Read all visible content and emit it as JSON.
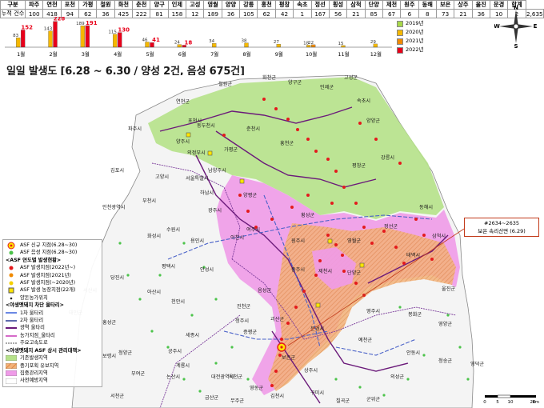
{
  "table": {
    "headers": [
      "구분",
      "파주",
      "연천",
      "포천",
      "가평",
      "철원",
      "화천",
      "춘천",
      "양구",
      "인제",
      "고성",
      "영월",
      "양양",
      "강릉",
      "홍천",
      "평창",
      "속초",
      "정선",
      "횡성",
      "삼척",
      "단양",
      "제천",
      "원주",
      "동해",
      "보은",
      "상주",
      "울진",
      "문경",
      "합계"
    ],
    "values": [
      "누적 건수",
      "100",
      "418",
      "94",
      "62",
      "36",
      "425",
      "222",
      "81",
      "158",
      "12",
      "189",
      "36",
      "105",
      "62",
      "42",
      "1",
      "167",
      "56",
      "21",
      "85",
      "67",
      "6",
      "8",
      "73",
      "21",
      "36",
      "10",
      "2",
      "2,635"
    ]
  },
  "chart": {
    "months": [
      "1월",
      "2월",
      "3월",
      "4월",
      "5월",
      "6월",
      "7월",
      "8월",
      "9월",
      "10월",
      "11월",
      "12월"
    ],
    "series": [
      {
        "name": "2019년",
        "color": "#a8d84a",
        "values": [
          null,
          null,
          null,
          null,
          null,
          null,
          null,
          null,
          null,
          null,
          null,
          null
        ]
      },
      {
        "name": "2020년",
        "color": "#f5b800",
        "values": [
          83,
          143,
          189,
          115,
          46,
          24,
          34,
          38,
          27,
          18,
          15,
          29
        ]
      },
      {
        "name": "2021년",
        "color": "#f08a00",
        "values": [
          null,
          null,
          null,
          null,
          null,
          null,
          null,
          null,
          null,
          22,
          null,
          null
        ]
      },
      {
        "name": "2022년",
        "color": "#e8001a",
        "values": [
          152,
          228,
          191,
          130,
          41,
          18,
          null,
          null,
          null,
          null,
          null,
          null
        ]
      }
    ],
    "extra_labels": [
      {
        "month": "10월",
        "value": "12"
      },
      {
        "month": "12월",
        "value": "72"
      },
      {
        "month": "11월",
        "value": "22"
      }
    ]
  },
  "map": {
    "title": "일일 발생도 [6.28 ~ 6.30 / 양성 2건, 음성 675건]",
    "callout": {
      "line1": "#2634~2635",
      "line2": "보은 속리산면 (6.29)"
    },
    "places": [
      "철원군",
      "화천군",
      "양구군",
      "인제군",
      "고성군",
      "속초시",
      "양양군",
      "강릉시",
      "평창군",
      "홍천군",
      "춘천시",
      "가평군",
      "포천시",
      "연천군",
      "파주시",
      "양주시",
      "동두천시",
      "의정부시",
      "남양주시",
      "고양시",
      "김포시",
      "부천시",
      "인천광역시",
      "서울특별시",
      "하남시",
      "광주시",
      "양평군",
      "여주시",
      "이천시",
      "안성시",
      "평택시",
      "화성시",
      "당진시",
      "아산시",
      "천안시",
      "청주시",
      "세종시",
      "대전광역시",
      "공주시",
      "옥천군",
      "보은군",
      "괴산군",
      "충주시",
      "제천시",
      "단양군",
      "원주시",
      "횡성군",
      "영월군",
      "정선군",
      "태백시",
      "삼척시",
      "동해시",
      "봉화군",
      "영주시",
      "예천군",
      "문경시",
      "상주시",
      "안동시",
      "영양군",
      "울진군",
      "청송군",
      "영덕군",
      "구미시",
      "김천시",
      "의성군",
      "음성군",
      "진천군",
      "증평군",
      "용인시",
      "수원시",
      "논산시",
      "부여군",
      "청양군",
      "홍성군",
      "서산시",
      "태안군",
      "보령시",
      "서천군",
      "무주군",
      "영동군",
      "금산군",
      "계룡시",
      "칠곡군",
      "군위군"
    ],
    "compass": {
      "n": "N",
      "s": "S",
      "e": "E",
      "w": "W"
    },
    "scale": {
      "ticks": [
        "0",
        "5",
        "10",
        "20"
      ],
      "unit": "km"
    }
  },
  "legend": {
    "title_icon_new": "ASF 신규 지점(6.28~30)",
    "neg_new": "ASF 음성 지점(6.28~30)",
    "sec1": "<ASF 연도별 발생현황>",
    "y2022": "ASF 발생지점(2022년~)",
    "y2021": "ASF 발생지점(2021년)",
    "y2020": "ASF 발생지점(~2020년)",
    "farm": "ASF 발생 농장지점(22개)",
    "pigfarm": "양돈농가위치",
    "sec2": "<야생멧돼지 차단 울타리>",
    "f1": "1차 울타리",
    "f2": "2차 울타리",
    "f3": "광역 울타리",
    "f4": "농가지점_울타리",
    "road": "주요고속도로",
    "sec3": "<야생멧돼지 ASF 상시 관리대책>",
    "z1": "기존발생지역",
    "z2": "중기포획 유보지역",
    "z3": "집중관리지역",
    "z4": "사전예방지역"
  }
}
